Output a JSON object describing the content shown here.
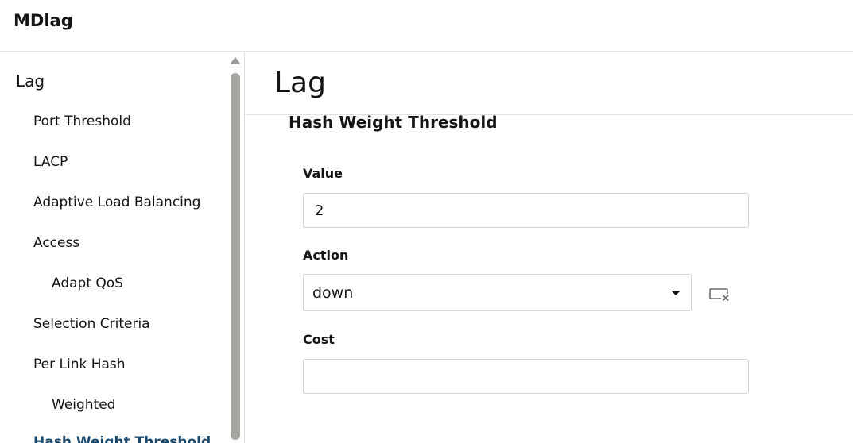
{
  "app": {
    "title": "MDlag"
  },
  "sidebar": {
    "items": [
      {
        "label": "Lag",
        "level": 0
      },
      {
        "label": "Port Threshold",
        "level": 1
      },
      {
        "label": "LACP",
        "level": 1
      },
      {
        "label": "Adaptive Load Balancing",
        "level": 1
      },
      {
        "label": "Access",
        "level": 1
      },
      {
        "label": "Adapt QoS",
        "level": 2
      },
      {
        "label": "Selection Criteria",
        "level": 1
      },
      {
        "label": "Per Link Hash",
        "level": 1
      },
      {
        "label": "Weighted",
        "level": 2
      },
      {
        "label": "Hash Weight Threshold",
        "level": 2,
        "active": true
      }
    ]
  },
  "main": {
    "title": "Lag",
    "section_title": "Hash Weight Threshold",
    "fields": {
      "value": {
        "label": "Value",
        "value": "2"
      },
      "action": {
        "label": "Action",
        "selected": "down"
      },
      "cost": {
        "label": "Cost",
        "value": ""
      }
    }
  },
  "icons": {
    "scroll_up": "arrow-up-icon",
    "select_caret": "chevron-down-icon",
    "clear": "clear-field-icon"
  },
  "colors": {
    "text": "#161513",
    "active_nav": "#1b4a6e",
    "border": "#d7d4d0",
    "scrollbar": "#a6a4a1"
  }
}
